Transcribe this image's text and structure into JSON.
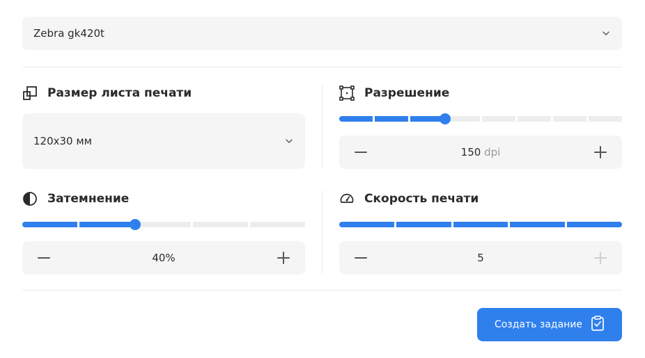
{
  "printer_select": {
    "value": "Zebra gk420t",
    "icon": "chevron-down-icon"
  },
  "paper_size": {
    "title": "Размер листа печати",
    "icon": "paper-size-icon",
    "select_value": "120x30 мм"
  },
  "resolution": {
    "title": "Разрешение",
    "icon": "resolution-icon",
    "value": "150",
    "unit": "dpi",
    "slider_segments": 8,
    "slider_level": 0.375,
    "plus_enabled": true,
    "minus_enabled": true
  },
  "darkness": {
    "title": "Затемнение",
    "icon": "contrast-icon",
    "value": "40%",
    "slider_segments": 5,
    "slider_level": 0.4,
    "plus_enabled": true,
    "minus_enabled": true
  },
  "print_speed": {
    "title": "Скорость печати",
    "icon": "speedometer-icon",
    "value": "5",
    "slider_segments": 5,
    "slider_level": 1.0,
    "plus_enabled": false,
    "minus_enabled": true
  },
  "create_button": {
    "label": "Создать задание",
    "icon": "clipboard-check-icon"
  },
  "colors": {
    "accent": "#2f80ed",
    "track": "#ededed",
    "field_bg": "#f5f5f5"
  }
}
